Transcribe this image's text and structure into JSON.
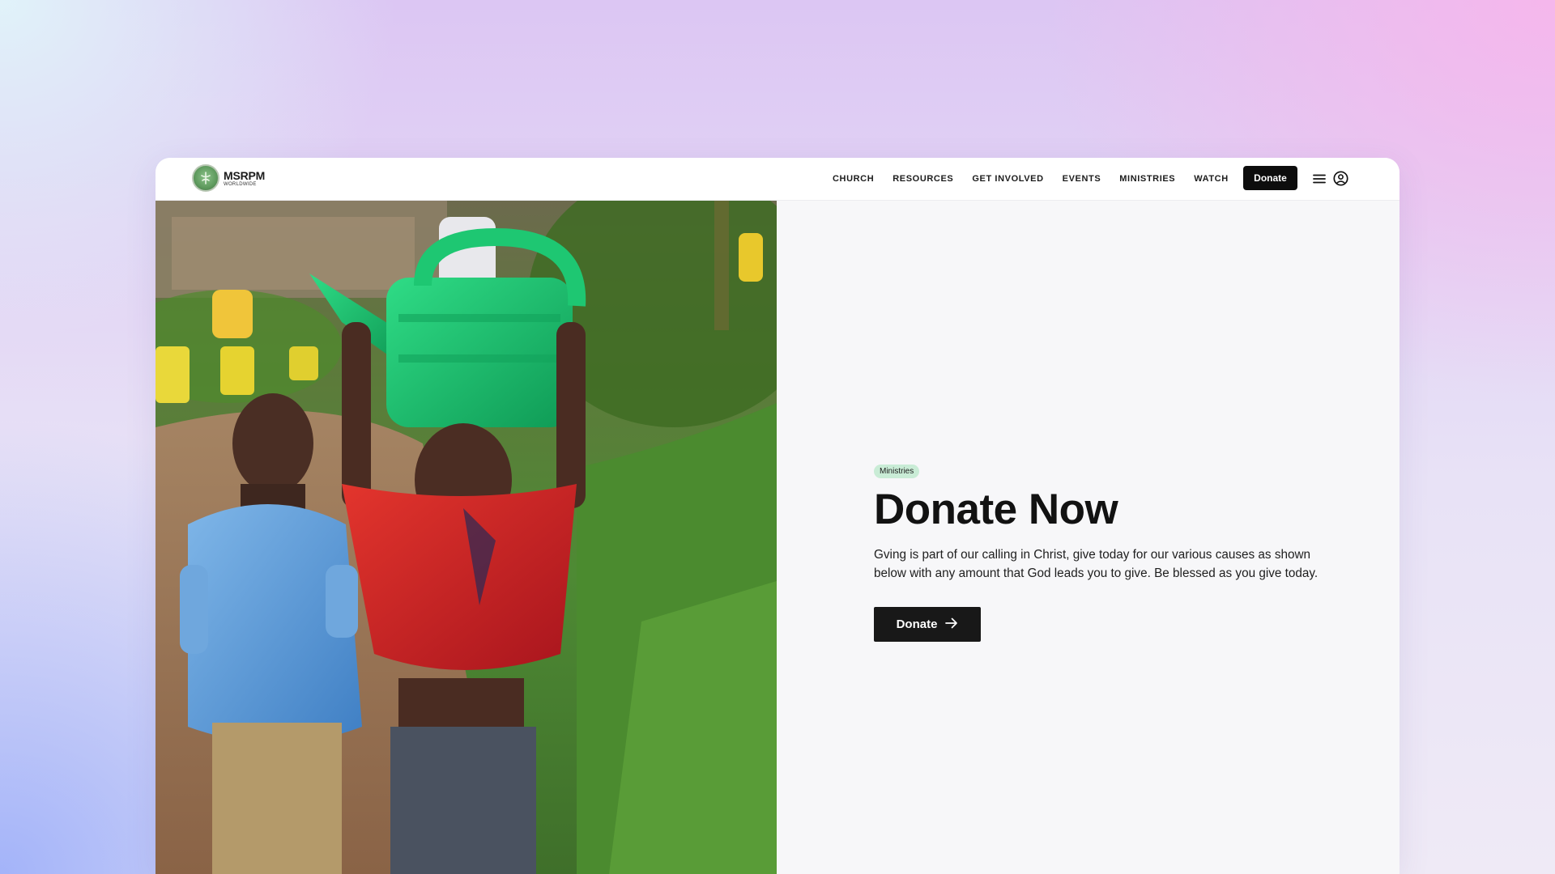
{
  "header": {
    "logo_name": "MSRPM",
    "logo_sub": "WORLDWIDE",
    "nav": [
      "CHURCH",
      "RESOURCES",
      "GET INVOLVED",
      "EVENTS",
      "MINISTRIES",
      "WATCH"
    ],
    "donate_label": "Donate",
    "icons": [
      "hamburger-menu-icon",
      "user-circle-icon"
    ]
  },
  "hero": {
    "image": "children-carrying-green-watering-can-photo",
    "badge": "Ministries",
    "title": "Donate Now",
    "description": "Gving is part of our calling in Christ, give today for our various causes as shown below with any amount that God leads you to give. Be blessed as you give today.",
    "cta_label": "Donate",
    "cta_icon": "arrow-right-icon"
  },
  "colors": {
    "accent_dark": "#0d0d0d",
    "badge_bg": "#c9ecd6",
    "panel_bg": "#f7f7f9"
  }
}
